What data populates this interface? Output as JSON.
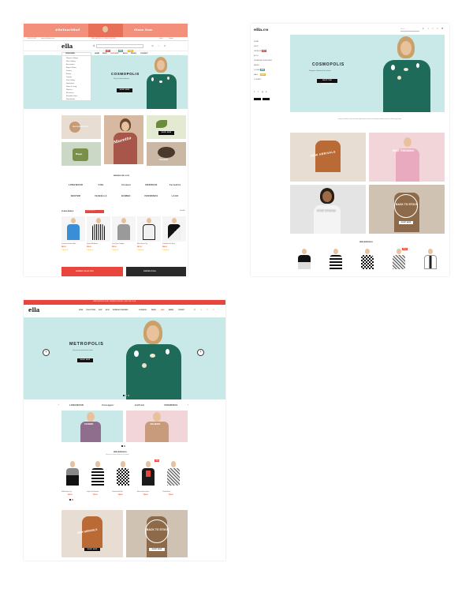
{
  "frame1": {
    "promo_banner_left": "#BeYourMind",
    "promo_banner_right": "Store Now",
    "topbar_phone": "+1 800 123 4567",
    "topbar_email": "support@ellatheme.com",
    "topbar_message": "FREE SHIPPING ON ORDERS OVER $99",
    "topbar_links": [
      "Sign In",
      "Register"
    ],
    "logo": "ella",
    "nav": [
      "CATEGORIES",
      "HOME",
      "SHOP",
      "FEATURED",
      "BLOG",
      "PAGES",
      "CONTACT"
    ],
    "nav_badges": [
      "HOT",
      "NEW",
      "SALE"
    ],
    "category_menu": [
      "Women Clothing",
      "Men Clothing",
      "Accessories",
      "Bags & Shoes",
      "Jewelry",
      "Beauty",
      "Lingerie",
      "Kids & Baby",
      "Sportswear",
      "Home & Living",
      "Watches",
      "Electronics",
      "Bestseller Items",
      "New Arrivals"
    ],
    "hero_title": "COSMOPOLIS",
    "hero_sub": "Shop the latest collection",
    "hero_btn": "SHOP NOW",
    "grid_labels": [
      "Accessories",
      "Muretto",
      "Sweater",
      "Bags"
    ],
    "grid_btn": "SHOP NOW",
    "brands_title": "BRANDS WE LOVE",
    "brands": [
      "LONGWOOD",
      "VOG",
      "Ironman",
      "MERIDIAN",
      "Carmelita",
      "NESTBR",
      "ISABELLA",
      "BOMBO",
      "FERMENCE",
      "LAGO"
    ],
    "flash_title": "FLASH DEALS",
    "flash_timer": "02 : 14 : 36 : 52",
    "flash_viewall": "View All",
    "products": [
      {
        "name": "Cashmere Sweater Blue",
        "price": "$45.00"
      },
      {
        "name": "Striped Silk Blouse",
        "price": "$38.00"
      },
      {
        "name": "Grey Open Cardigan",
        "price": "$52.00"
      },
      {
        "name": "Mesh Sleeve Top",
        "price": "$41.00"
      },
      {
        "name": "Colorblock Knit Dress",
        "price": "$64.00"
      }
    ],
    "bottom_banners": [
      "SUMMER COLLECTION",
      "STRIPED STYLE"
    ]
  },
  "frame2": {
    "logo": "ella.co",
    "search_placeholder": "Search",
    "sidebar_nav": [
      "HOME",
      "SHOP",
      "CATEGORY",
      "BLOG",
      "WOMEN ACCESSORIES",
      "PAGES",
      "LOOKBOOK",
      "SALE",
      "CONTACT"
    ],
    "sidebar_badges": [
      "HOT",
      "NEW",
      "SALE"
    ],
    "hero_title": "COSMOPOLIS",
    "hero_sub": "Designers collection of the season",
    "hero_btn": "SHOP THE COLLECTION",
    "intro_text": "Lorem ipsum dolor sit amet consectetur adipiscing elit sed do eiusmod tempor incididunt ut labore et dolore magna aliqua",
    "tiles": [
      "NEW ARRIVALS",
      "RING TRENDING",
      "MOST WANTED",
      "BACK TO STOCK"
    ],
    "tile_btn": "SHOP NOW",
    "new_arrivals_title": "NEW ARRIVALS",
    "sale_label": "SALE"
  },
  "frame3": {
    "promo_bar": "FREE SHIPPING ON ALL ORDERS OVER $99 - USE CODE: ELLA",
    "logo": "ella",
    "nav": [
      "HOME",
      "COLLECTIONS",
      "SHOP",
      "BLOG",
      "WOMEN ACCESSORIES",
      "LOOKBOOK",
      "PAGES",
      "SALE",
      "BRAND",
      "CONTACT"
    ],
    "hero_title": "METROPOLIS",
    "hero_sub": "Discover the new season trends",
    "hero_btn": "SHOP NOW",
    "brands": [
      "LONGWOOD",
      "Conseguir",
      "Jieffrom",
      "FERMENCE"
    ],
    "promo_tiles": [
      "COSMO",
      "JOLIERO"
    ],
    "promo_btn": "SHOP NOW",
    "new_arrivals_title": "NEW ARRIVALS",
    "new_arrivals_sub": "Discover our latest arrivals for this season",
    "products": [
      {
        "name": "Ruffle Peplum Top",
        "price": "$42.00"
      },
      {
        "name": "Graphic Knit Sweater",
        "price": "$55.00"
      },
      {
        "name": "Patterned Silk Shirt",
        "price": "$48.00"
      },
      {
        "name": "Black Leather Jacket",
        "price": "$89.00"
      },
      {
        "name": "Printed Blouse",
        "price": "$39.00"
      }
    ],
    "tiles": [
      "NEW ARRIVALS",
      "BACK TO STOCK"
    ],
    "tile_btn": "SHOP NOW"
  },
  "colors": {
    "coral": "#f3907c",
    "teal_bg": "#c9e9e9",
    "red": "#e8453c",
    "dark_green": "#1f6b5a",
    "pink_bg": "#f1d5d9",
    "beige_bg": "#e7ddd2"
  }
}
